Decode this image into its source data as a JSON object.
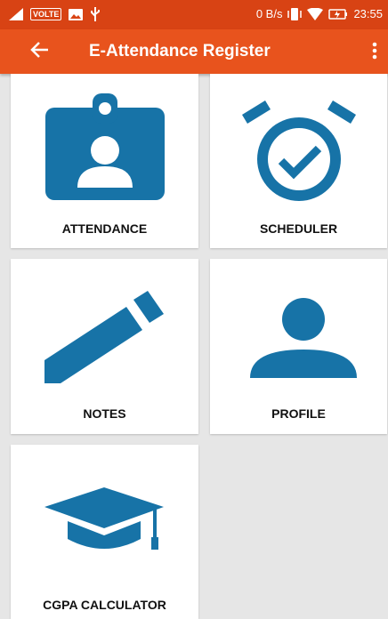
{
  "status_bar": {
    "volte": "VOLTE",
    "speed": "0 B/s",
    "time": "23:55"
  },
  "toolbar": {
    "title": "E-Attendance Register"
  },
  "tiles": [
    {
      "label": "ATTENDANCE",
      "icon": "id-badge-icon"
    },
    {
      "label": "SCHEDULER",
      "icon": "alarm-clock-check-icon"
    },
    {
      "label": "NOTES",
      "icon": "pencil-icon"
    },
    {
      "label": "PROFILE",
      "icon": "person-icon"
    },
    {
      "label": "CGPA CALCULATOR",
      "icon": "graduation-cap-icon"
    }
  ],
  "colors": {
    "status_bar": "#d84314",
    "toolbar": "#e8531d",
    "icon": "#1773a7",
    "background": "#e6e6e6"
  }
}
